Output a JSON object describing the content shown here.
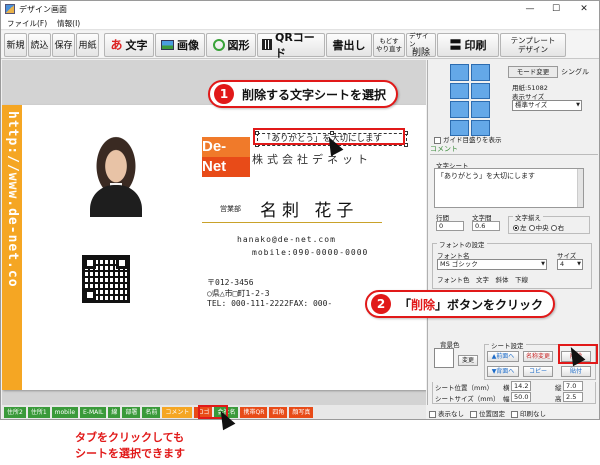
{
  "window": {
    "title": "デザイン画面",
    "controls": {
      "minimize": "—",
      "maximize": "☐",
      "close": "✕"
    }
  },
  "menu": [
    "ファイル(F)",
    "情報(I)"
  ],
  "toolbar": {
    "new": "新規",
    "open": "読込",
    "save": "保存",
    "paper": "用紙",
    "text": "文字",
    "image": "画像",
    "shape": "図形",
    "qr": "QRコード",
    "write": "書出し",
    "undo_line1": "もどす",
    "undo_line2": "やり直す",
    "design_line1": "デザイン",
    "design_line2": "削除",
    "print": "印刷",
    "template_line1": "テンプレート",
    "template_line2": "デザイン"
  },
  "card": {
    "url": "http://www.de-net.co",
    "logo_top": "De-",
    "logo_bottom": "Net",
    "selected_text": "「ありがとう」を大切にします",
    "company": "株式会社デネット",
    "department": "営業部",
    "name": "名刺 花子",
    "email": "hanako@de-net.com",
    "mobile": "mobile:090-0000-0000",
    "postal": "〒012-3456",
    "address": "○県△市□町1-2-3",
    "tel_fax": "TEL: 000-111-2222FAX: 000-"
  },
  "callouts": {
    "step1_num": "1",
    "step1_text": "削除する文字シートを選択",
    "step2_num": "2",
    "step2_open": "「",
    "step2_emph": "削除",
    "step2_rest": "」ボタンをクリック",
    "caption_line1": "タブをクリックしても",
    "caption_line2": "シートを選択できます"
  },
  "right_panel": {
    "mode_change": "モード変更",
    "single": "シングル",
    "paper_code": "用紙:51082",
    "display_size_label": "表示サイズ",
    "display_size_value": "標準サイズ",
    "guide_label": "ガイド目盛りを表示",
    "comment_tab": "コメント",
    "text_sheet_label": "文字シート",
    "text_sheet_value": "「ありがとう」を大切にします",
    "line_spacing_label": "行間",
    "line_spacing_value": "0",
    "char_spacing_label": "文字間",
    "char_spacing_value": "0.6",
    "align_label": "文字揃え",
    "align_left": "左",
    "align_center": "中央",
    "align_right": "右",
    "font_settings_label": "フォントの設定",
    "font_name_label": "フォント名",
    "font_name_value": "MS ゴシック",
    "size_label": "サイズ",
    "size_value": "4",
    "font_style_labels": "フォント色　文字　斜体　下線",
    "bg_color_label": "背景色",
    "change_button": "変更",
    "sheet_settings_label": "シート設定",
    "to_front": "▲前面へ",
    "rename": "名称変更",
    "delete": "削除",
    "to_back": "▼背面へ",
    "copy": "コピー",
    "paste": "貼付",
    "sheet_pos_label": "シート位置（mm）",
    "pos_x_label": "横",
    "pos_x_value": "14.2",
    "pos_y_label": "縦",
    "pos_y_value": "7.0",
    "sheet_size_label": "シートサイズ（mm）",
    "width_label": "幅",
    "width_value": "50.0",
    "height_label": "高",
    "height_value": "2.5",
    "hide_label": "表示なし",
    "lock_label": "位置固定",
    "noprint_label": "印刷なし"
  },
  "sheet_tabs": [
    {
      "label": "住所2",
      "color": "#3a9a3a"
    },
    {
      "label": "住所1",
      "color": "#3a9a3a"
    },
    {
      "label": "mobile",
      "color": "#3a9a3a"
    },
    {
      "label": "E-MAIL",
      "color": "#3a9a3a"
    },
    {
      "label": "線",
      "color": "#3a9a3a"
    },
    {
      "label": "部署",
      "color": "#3a9a3a"
    },
    {
      "label": "名前",
      "color": "#3a9a3a"
    },
    {
      "label": "コメント",
      "color": "#f5a623"
    },
    {
      "label": "ロゴ",
      "color": "#e84b18"
    },
    {
      "label": "会社名",
      "color": "#3a9a3a"
    },
    {
      "label": "携帯QR",
      "color": "#e84b18"
    },
    {
      "label": "四角",
      "color": "#e84b18"
    },
    {
      "label": "顔写真",
      "color": "#e84b18"
    }
  ],
  "colors": {
    "accent_red": "#e11919",
    "orange": "#f5a623",
    "logo_orange": "#f07a2a",
    "gold_line": "#c9a22a"
  }
}
